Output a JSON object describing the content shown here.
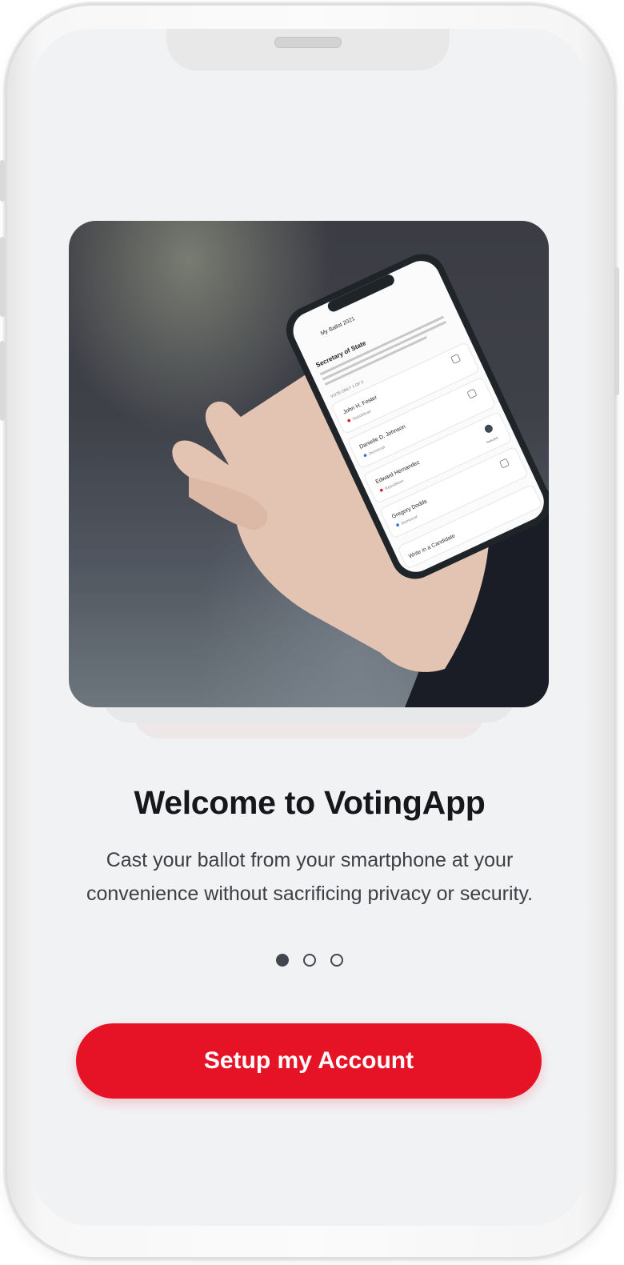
{
  "welcome": {
    "title": "Welcome to VotingApp",
    "subtitle": "Cast your ballot from your smartphone at your convenience without sacrificing privacy or security."
  },
  "pagination": {
    "total": 3,
    "active_index": 0
  },
  "actions": {
    "setup_label": "Setup my Account"
  },
  "hero_phone_screen": {
    "header_title": "My Ballot 2021",
    "section_title": "Secretary of State",
    "section_desc": "The Secretary of State is the chief elections officer, overseeing all federal and state elections in the state and maintaining a database of  Read More",
    "vote_hint": "VOTE ONLY 1 OF 5",
    "candidates": [
      {
        "name": "John H. Foster",
        "party": "Republican",
        "party_color": "#e61226",
        "selected": false
      },
      {
        "name": "Danielle D. Johnson",
        "party": "Democrat",
        "party_color": "#2f6fe0",
        "selected": false
      },
      {
        "name": "Edward Hernandez",
        "party": "Republican",
        "party_color": "#e61226",
        "selected": true
      },
      {
        "name": "Gregory Dodds",
        "party": "Democrat",
        "party_color": "#2f6fe0",
        "selected": false
      }
    ],
    "selected_label": "Selected",
    "write_in_label": "Write in a Candidate"
  },
  "colors": {
    "accent": "#e61226",
    "background": "#f1f2f4",
    "dot": "#3f4750",
    "title": "#15171b"
  }
}
